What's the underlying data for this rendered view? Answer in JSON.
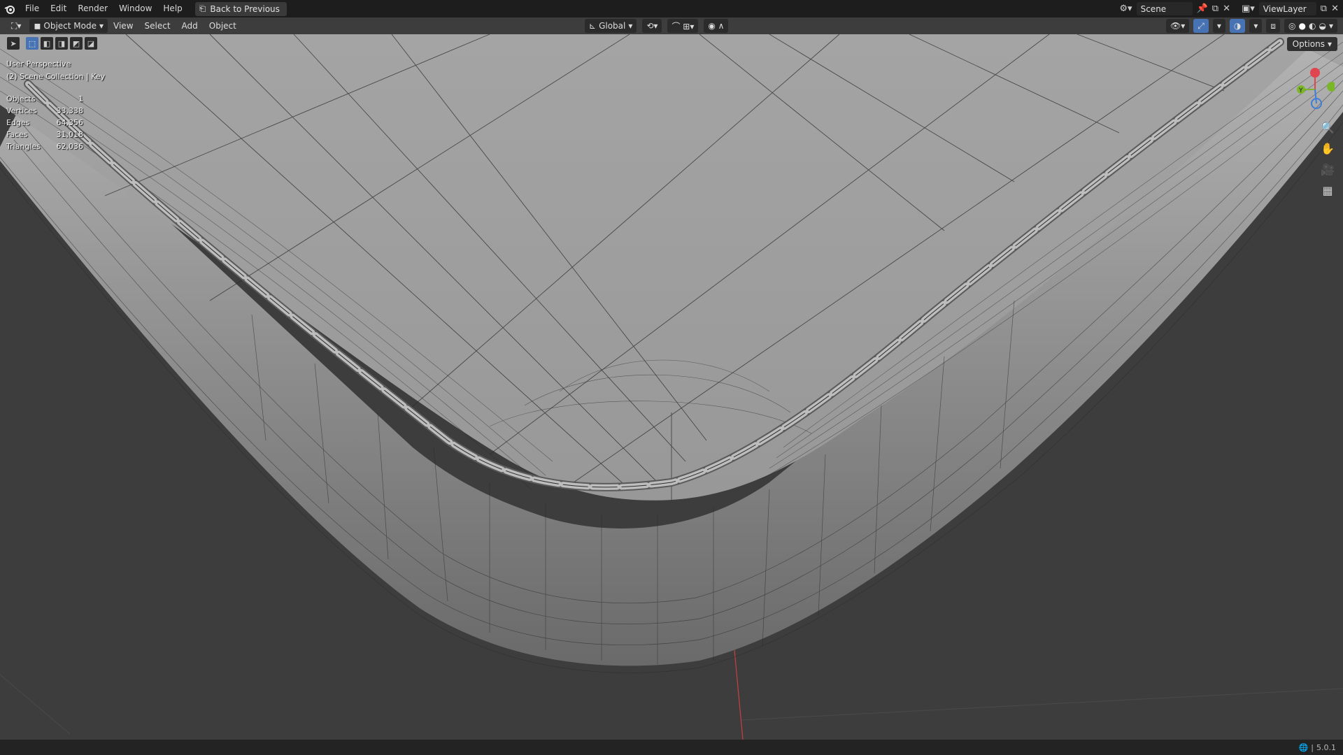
{
  "menubar": {
    "items": [
      "File",
      "Edit",
      "Render",
      "Window",
      "Help"
    ],
    "back_label": "Back to Previous",
    "scene_label": "Scene",
    "viewlayer_label": "ViewLayer"
  },
  "viewport_header": {
    "mode_label": "Object Mode",
    "menus": [
      "View",
      "Select",
      "Add",
      "Object"
    ],
    "orientation_label": "Global",
    "options_label": "Options"
  },
  "overlay": {
    "perspective": "User Perspective",
    "collection": "(2) Scene Collection | Key",
    "stats": [
      {
        "label": "Objects",
        "value": "1"
      },
      {
        "label": "Vertices",
        "value": "33,338"
      },
      {
        "label": "Edges",
        "value": "64,356"
      },
      {
        "label": "Faces",
        "value": "31,018"
      },
      {
        "label": "Triangles",
        "value": "62,036"
      }
    ]
  },
  "gizmo": {
    "x_color": "#e0464f",
    "y_color": "#7bb528",
    "z_color": "#3f7ed6",
    "y_label": "Y"
  },
  "statusbar": {
    "version": "5.0.1"
  },
  "colors": {
    "accent": "#4772b3",
    "topbar_bg": "#1d1d1d",
    "viewport_bg": "#3d3d3d"
  }
}
